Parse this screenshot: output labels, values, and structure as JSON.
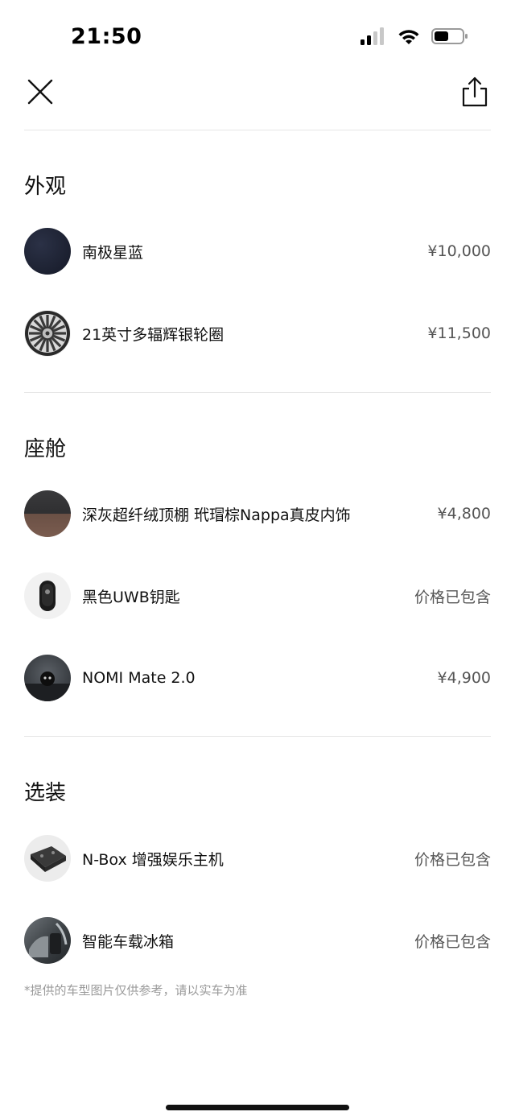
{
  "status_bar": {
    "time": "21:50"
  },
  "nav": {
    "close_icon": "close-icon",
    "share_icon": "share-icon"
  },
  "sections": [
    {
      "title": "外观",
      "items": [
        {
          "name": "南极星蓝",
          "price": "¥10,000",
          "thumb": "dark-blue-swatch"
        },
        {
          "name": "21英寸多辐辉银轮圈",
          "price": "¥11,500",
          "thumb": "wheel-rim"
        }
      ]
    },
    {
      "title": "座舱",
      "items": [
        {
          "name": "深灰超纤绒顶棚 玳瑁棕Nappa真皮内饰",
          "price": "¥4,800",
          "thumb": "interior-swatch"
        },
        {
          "name": "黑色UWB钥匙",
          "price": "价格已包含",
          "thumb": "uwb-key"
        },
        {
          "name": "NOMI Mate 2.0",
          "price": "¥4,900",
          "thumb": "nomi-device"
        }
      ]
    },
    {
      "title": "选装",
      "items": [
        {
          "name": "N-Box 增强娱乐主机",
          "price": "价格已包含",
          "thumb": "n-box-console"
        },
        {
          "name": "智能车载冰箱",
          "price": "价格已包含",
          "thumb": "car-fridge"
        }
      ]
    }
  ],
  "footnote": "*提供的车型图片仅供参考，请以实车为准",
  "colors": {
    "swatch_blue": "#1f2435",
    "text_primary": "#111111",
    "text_secondary": "#555555",
    "footnote": "#9a9a9a",
    "divider": "#e6e6e6"
  }
}
